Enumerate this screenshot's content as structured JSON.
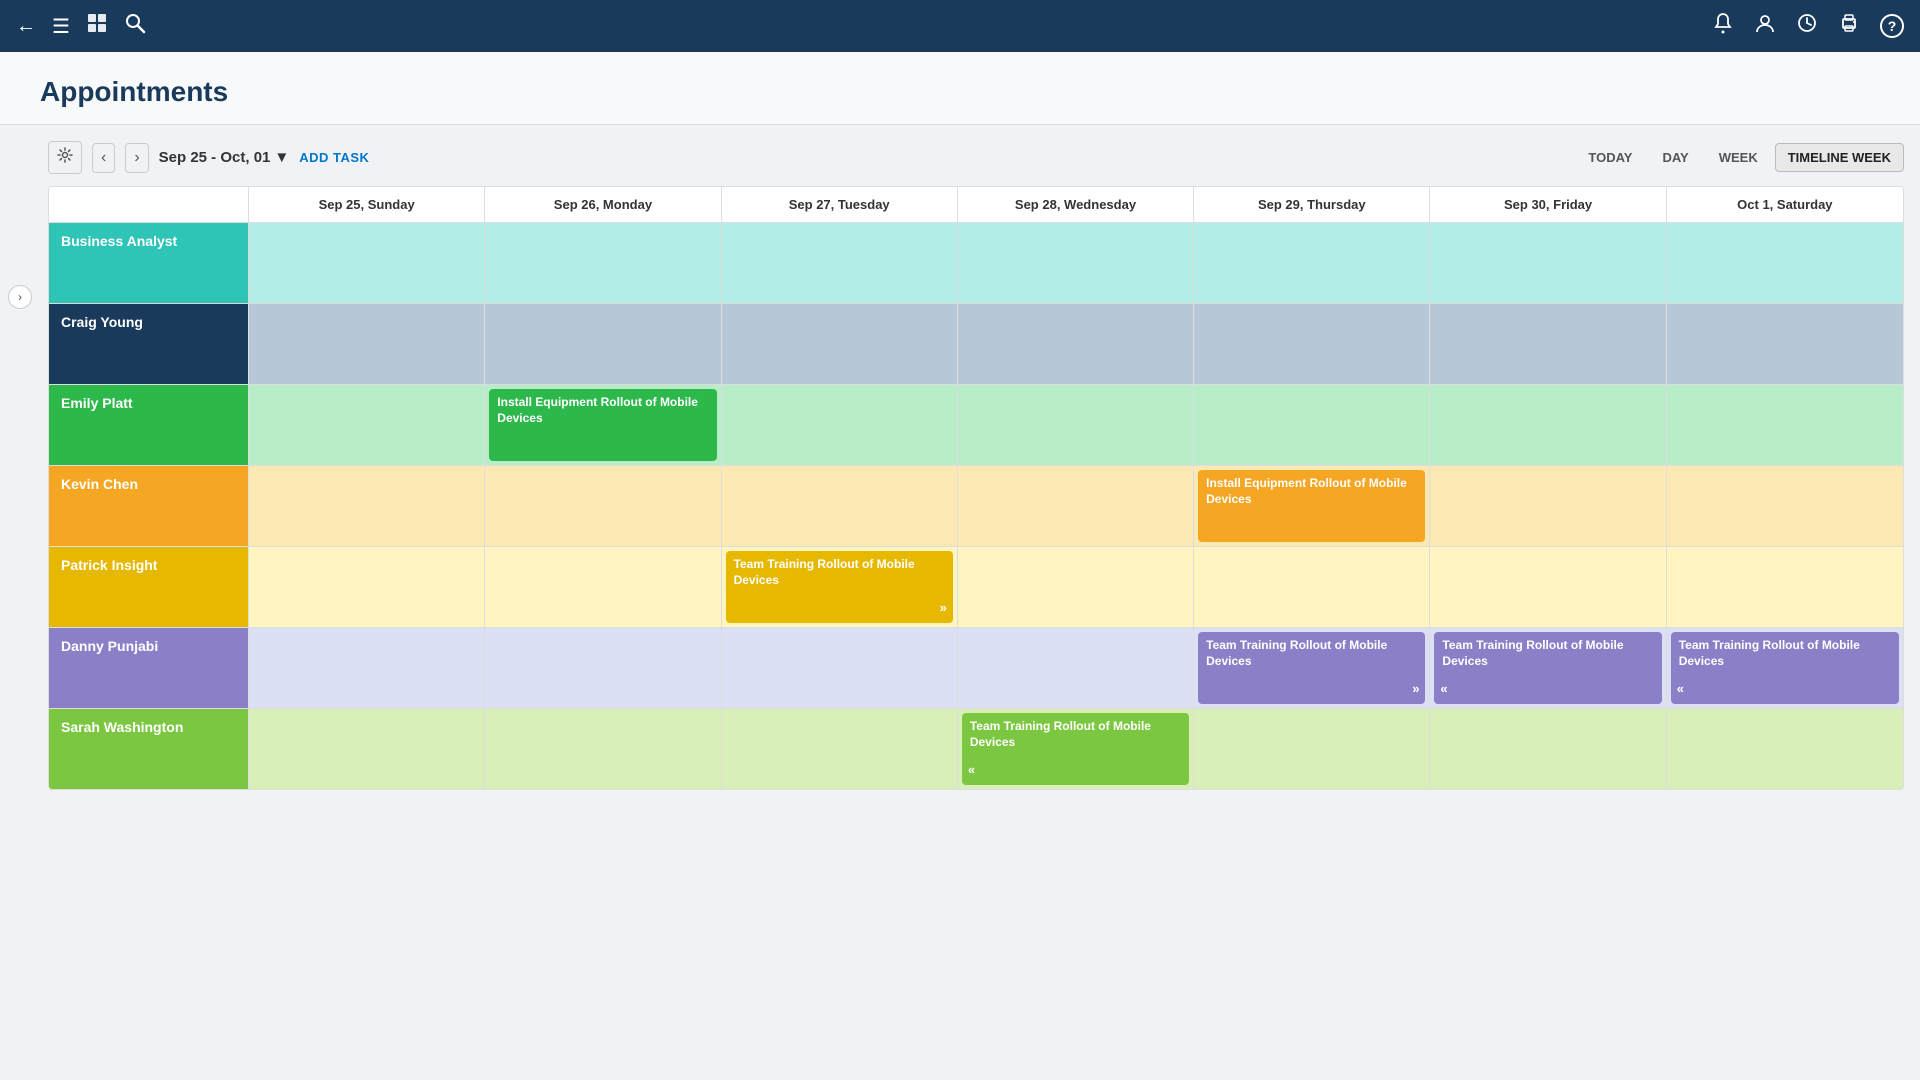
{
  "topbar": {
    "icons": {
      "back": "←",
      "menu": "☰",
      "building": "⊞",
      "search": "⌕",
      "bell": "🔔",
      "user": "👤",
      "clock": "⏱",
      "print": "🖨",
      "help": "?"
    }
  },
  "page": {
    "title": "Appointments"
  },
  "toolbar": {
    "settings_label": "⚙",
    "prev_label": "‹",
    "next_label": "›",
    "date_range": "Sep 25 - Oct, 01",
    "date_range_arrow": "▼",
    "add_task": "ADD TASK",
    "today": "TODAY",
    "day": "DAY",
    "week": "WEEK",
    "timeline_week": "TIMELINE WEEK"
  },
  "calendar": {
    "headers": [
      "",
      "Sep 25, Sunday",
      "Sep 26, Monday",
      "Sep 27, Tuesday",
      "Sep 28, Wednesday",
      "Sep 29, Thursday",
      "Sep 30, Friday",
      "Oct 1, Saturday"
    ],
    "rows": [
      {
        "name": "Business Analyst",
        "name_bg": "#2ec4b6",
        "row_bg": "#b2ede8",
        "events": [
          null,
          null,
          null,
          null,
          null,
          null,
          null
        ]
      },
      {
        "name": "Craig Young",
        "name_bg": "#1a3a5c",
        "row_bg": "#b8c7d8",
        "events": [
          null,
          null,
          null,
          null,
          null,
          null,
          null
        ]
      },
      {
        "name": "Emily Platt",
        "name_bg": "#2db84b",
        "row_bg": "#b8edca",
        "events": [
          null,
          {
            "text": "Install Equipment Rollout of Mobile Devices",
            "color": "#2db84b",
            "arrow": null
          },
          null,
          null,
          null,
          null,
          null
        ]
      },
      {
        "name": "Kevin Chen",
        "name_bg": "#f5a623",
        "row_bg": "#fce8b2",
        "events": [
          null,
          null,
          null,
          null,
          {
            "text": "Install Equipment Rollout of Mobile Devices",
            "color": "#f5a623",
            "arrow": null
          },
          null,
          null
        ]
      },
      {
        "name": "Patrick Insight",
        "name_bg": "#f5c518",
        "row_bg": "#fef5c0",
        "events": [
          null,
          null,
          {
            "text": "Team Training Rollout of Mobile Devices",
            "color": "#f5c518",
            "arrow": "right"
          },
          null,
          null,
          null,
          null
        ]
      },
      {
        "name": "Danny Punjabi",
        "name_bg": "#8b7fc7",
        "row_bg": "#dce0f5",
        "events": [
          null,
          null,
          null,
          null,
          {
            "text": "Team Training Rollout of Mobile Devices",
            "color": "#8b7fc7",
            "arrow": "right"
          },
          {
            "text": "Team Training Rollout of Mobile Devices",
            "color": "#8b7fc7",
            "arrow": "both"
          },
          {
            "text": "Team Training Rollout of Mobile Devices",
            "color": "#8b7fc7",
            "arrow": "left"
          }
        ]
      },
      {
        "name": "Sarah Washington",
        "name_bg": "#7cc742",
        "row_bg": "#d8f0b8",
        "events": [
          null,
          null,
          null,
          {
            "text": "Team Training Rollout of Mobile Devices",
            "color": "#7cc742",
            "arrow": "left"
          },
          null,
          null,
          null
        ]
      }
    ]
  }
}
